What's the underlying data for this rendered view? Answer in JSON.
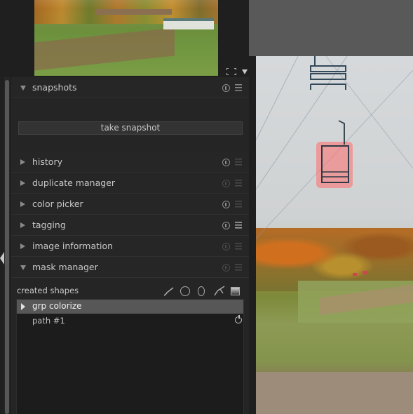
{
  "snapshots": {
    "title": "snapshots",
    "take_snapshot_label": "take snapshot"
  },
  "modules": [
    {
      "label": "history"
    },
    {
      "label": "duplicate manager"
    },
    {
      "label": "color picker"
    },
    {
      "label": "tagging"
    },
    {
      "label": "image information"
    }
  ],
  "mask_manager": {
    "title": "mask manager",
    "created_shapes_label": "created shapes",
    "shape_tools": [
      "brush-icon",
      "circle-icon",
      "ellipse-icon",
      "path-icon",
      "gradient-icon"
    ],
    "tree": {
      "group_name": "grp colorize",
      "items": [
        {
          "name": "path #1"
        }
      ]
    }
  },
  "colors": {
    "panel_bg": "#252525",
    "selected_row": "#575757",
    "mask_overlay": "#ff6b6b"
  }
}
